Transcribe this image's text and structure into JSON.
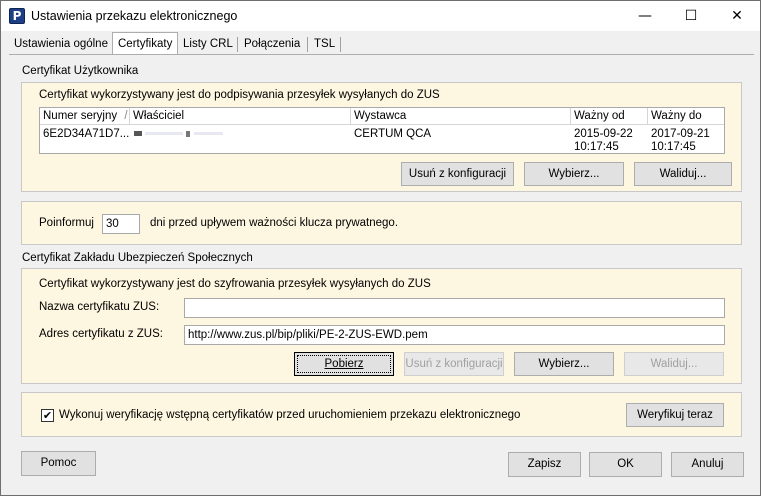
{
  "window": {
    "title": "Ustawienia przekazu elektronicznego",
    "app_icon_letter": "P",
    "controls": {
      "minimize": "—",
      "maximize": "☐",
      "close": "✕"
    }
  },
  "tabs": [
    {
      "label": "Ustawienia ogólne",
      "active": false
    },
    {
      "label": "Certyfikaty",
      "active": true
    },
    {
      "label": "Listy CRL",
      "active": false
    },
    {
      "label": "Połączenia",
      "active": false
    },
    {
      "label": "TSL",
      "active": false
    }
  ],
  "user_cert": {
    "group_label": "Certyfikat Użytkownika",
    "description": "Certyfikat wykorzystywany jest do podpisywania przesyłek wysyłanych do ZUS",
    "columns": [
      "Numer seryjny",
      "Właściciel",
      "Wystawca",
      "Ważny od",
      "Ważny do"
    ],
    "sort_indicator": "/",
    "rows": [
      {
        "serial": "6E2D34A71D7...",
        "owner": "",
        "issuer": "CERTUM QCA",
        "valid_from_date": "2015-09-22",
        "valid_from_time": "10:17:45",
        "valid_to_date": "2017-09-21",
        "valid_to_time": "10:17:45"
      }
    ],
    "buttons": {
      "remove": "Usuń z konfiguracji",
      "choose": "Wybierz...",
      "validate": "Waliduj..."
    }
  },
  "inform": {
    "prefix": "Poinformuj",
    "days_value": "30",
    "suffix": "dni przed upływem ważności klucza prywatnego."
  },
  "zus_cert": {
    "group_label": "Certyfikat Zakładu Ubezpieczeń Społecznych",
    "description": "Certyfikat wykorzystywany jest do szyfrowania przesyłek wysyłanych do ZUS",
    "name_label": "Nazwa certyfikatu ZUS:",
    "name_value": "",
    "address_label": "Adres certyfikatu z ZUS:",
    "address_value": "http://www.zus.pl/bip/pliki/PE-2-ZUS-EWD.pem",
    "buttons": {
      "download": "Pobierz",
      "remove": "Usuń z konfiguracji",
      "choose": "Wybierz...",
      "validate": "Waliduj..."
    }
  },
  "verify": {
    "checkbox_checked": true,
    "checkbox_mark": "✔",
    "label": "Wykonuj weryfikację wstępną certyfikatów przed uruchomieniem przekazu elektronicznego",
    "button": "Weryfikuj teraz"
  },
  "footer": {
    "help": "Pomoc",
    "save": "Zapisz",
    "ok": "OK",
    "cancel": "Anuluj"
  }
}
